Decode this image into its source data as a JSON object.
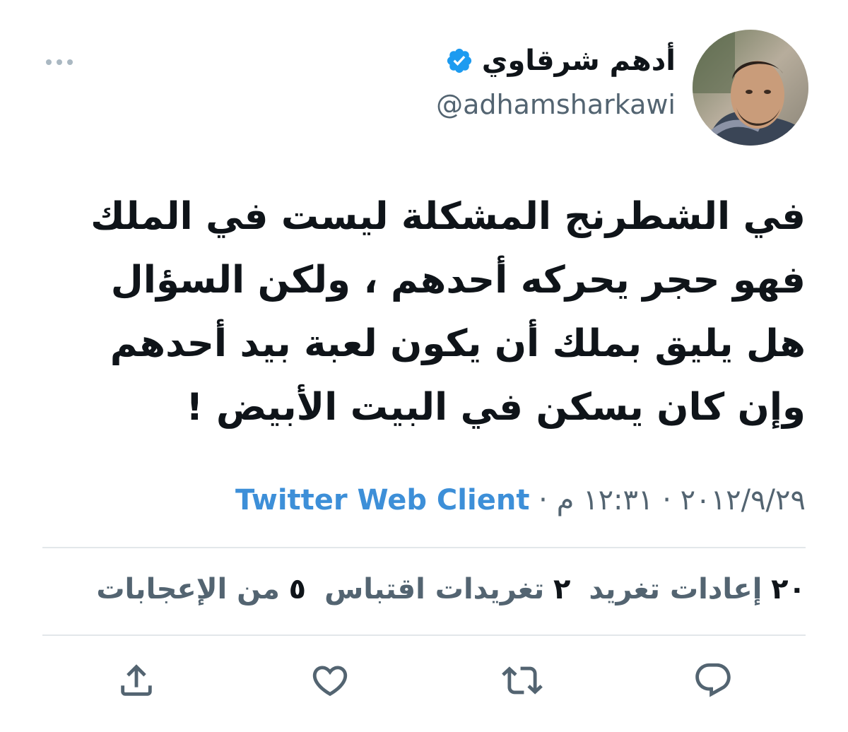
{
  "author": {
    "display_name": "أدهم شرقاوي",
    "handle": "@adhamsharkawi",
    "verified": true
  },
  "tweet": {
    "lines": [
      "في الشطرنج المشكلة ليست في الملك",
      "فهو  حجر يحركه أحدهم  ، ولكن السؤال",
      "هل يليق بملك أن يكون لعبة بيد أحدهم",
      "وإن كان يسكن في البيت الأبيض !"
    ]
  },
  "meta": {
    "date": "٢٠١٢/٩/٢٩",
    "separator": " · ",
    "time": "١٢:٣١ م",
    "source": "Twitter Web Client"
  },
  "stats": {
    "retweets_count": "٢٠",
    "retweets_label": "إعادات تغريد",
    "quotes_count": "٢",
    "quotes_label": "تغريدات اقتباس",
    "likes_count": "٥",
    "likes_label": "من الإعجابات"
  },
  "icons": {
    "more": "more-horizontal-icon",
    "verified": "verified-badge-icon",
    "reply": "reply-icon",
    "retweet": "retweet-icon",
    "like": "heart-icon",
    "share": "share-icon"
  },
  "colors": {
    "text": "#0f1419",
    "secondary": "#536471",
    "link": "#3d8fd8",
    "verified": "#1d9bf0",
    "divider": "#e3e7ea"
  }
}
